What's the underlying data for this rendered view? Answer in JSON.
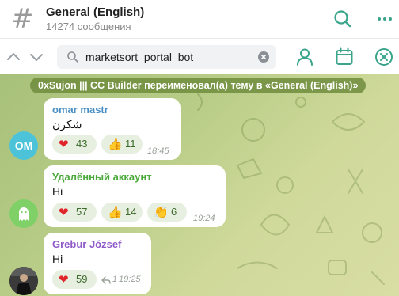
{
  "header": {
    "icon": "hash-icon",
    "hash_glyph": "#",
    "title": "General (English)",
    "subtitle": "14274 сообщения",
    "accent": "#3aa58a"
  },
  "searchbar": {
    "query": "marketsort_portal_bot",
    "icons": [
      "chevron-up-icon",
      "chevron-down-icon",
      "search-icon",
      "clear-icon",
      "user-icon",
      "calendar-icon",
      "close-icon"
    ]
  },
  "chat": {
    "service_message": "0xSujon ||| CC Builder переименовал(а) тему в «General (English)»",
    "messages": [
      {
        "sender": "omar mastr",
        "sender_color": "#4a8fc4",
        "avatar_initials": "OM",
        "avatar_color": "#4cc3d9",
        "text": "شكرن",
        "reactions": [
          {
            "emoji": "❤",
            "icon": "heart-icon",
            "count": "43"
          },
          {
            "emoji": "👍",
            "icon": "thumbs-up-icon",
            "count": "11"
          }
        ],
        "time": "18:45"
      },
      {
        "sender": "Удалённый аккаунт",
        "sender_color": "#4caa3c",
        "avatar_icon": "ghost-icon",
        "avatar_color": "#7ed067",
        "text": "Hi",
        "reactions": [
          {
            "emoji": "❤",
            "icon": "heart-icon",
            "count": "57"
          },
          {
            "emoji": "👍",
            "icon": "thumbs-up-icon",
            "count": "14"
          },
          {
            "emoji": "👏",
            "icon": "clap-icon",
            "count": "6"
          }
        ],
        "time": "19:24"
      },
      {
        "sender": "Grebur József",
        "sender_color": "#8e5ac8",
        "avatar_icon": "photo-avatar",
        "text": "Hi",
        "reactions": [
          {
            "emoji": "❤",
            "icon": "heart-icon",
            "count": "59"
          }
        ],
        "reply_icon": "reply-icon",
        "reply_count": "1",
        "time": "19:25"
      }
    ]
  }
}
